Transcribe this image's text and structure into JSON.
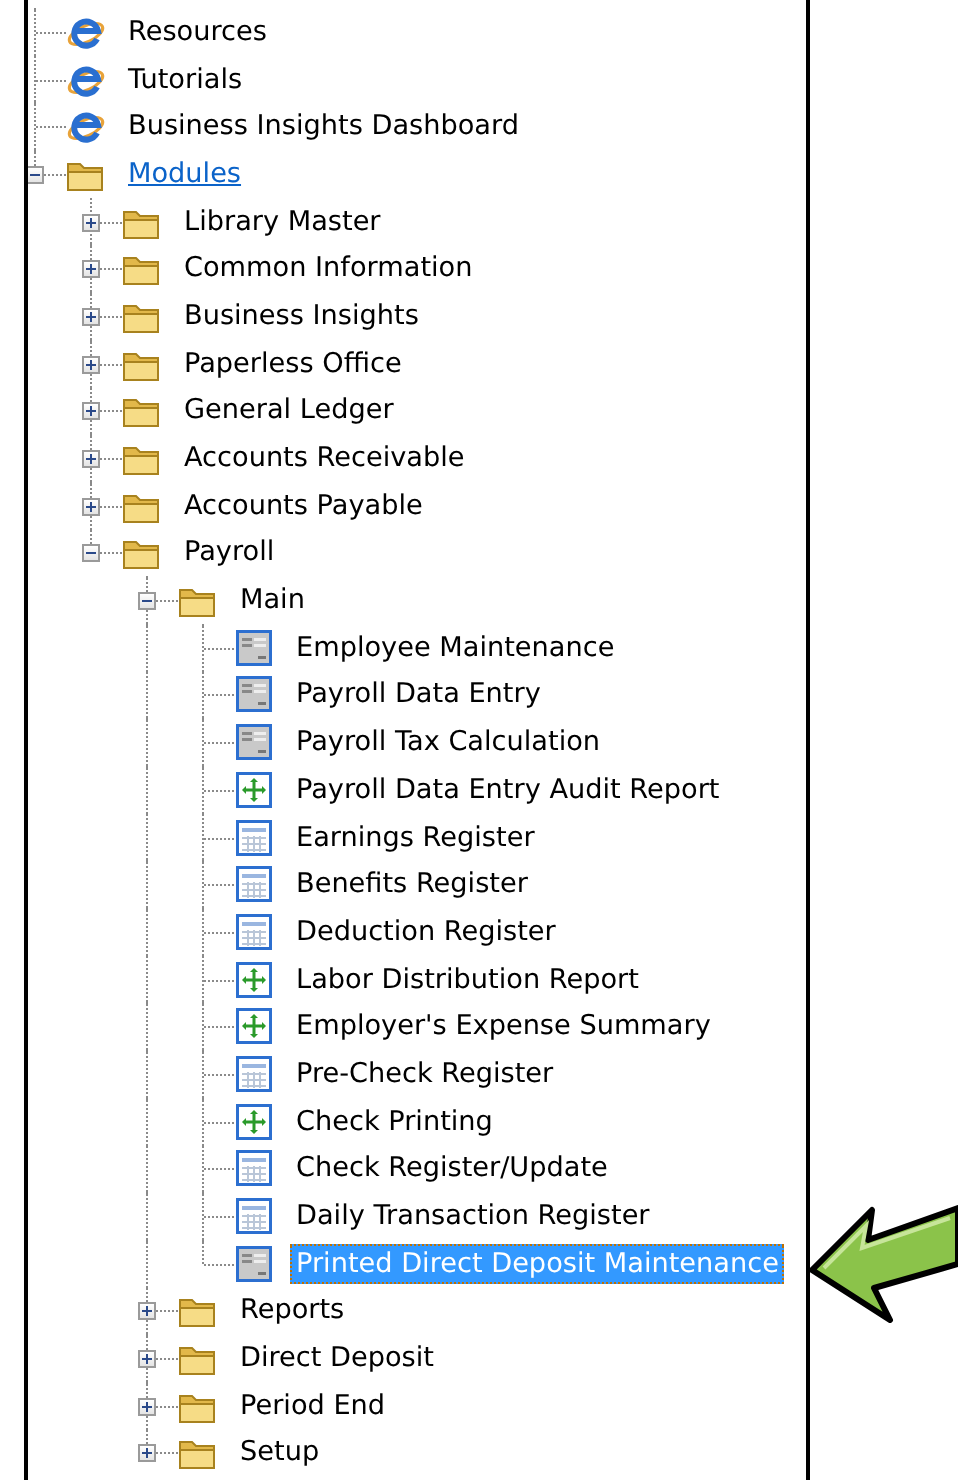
{
  "tree": [
    {
      "label": "Resources",
      "kind": "web",
      "selected": false,
      "hot": false
    },
    {
      "label": "Tutorials",
      "kind": "web",
      "selected": false,
      "hot": false
    },
    {
      "label": "Business Insights Dashboard",
      "kind": "web",
      "selected": false,
      "hot": false
    },
    {
      "label": "Modules",
      "kind": "folder",
      "expanded": true,
      "selected": false,
      "hot": true,
      "children": [
        {
          "label": "Library Master",
          "kind": "folder",
          "expanded": false,
          "selected": false,
          "hot": false
        },
        {
          "label": "Common Information",
          "kind": "folder",
          "expanded": false,
          "selected": false,
          "hot": false
        },
        {
          "label": "Business Insights",
          "kind": "folder",
          "expanded": false,
          "selected": false,
          "hot": false
        },
        {
          "label": "Paperless Office",
          "kind": "folder",
          "expanded": false,
          "selected": false,
          "hot": false
        },
        {
          "label": "General Ledger",
          "kind": "folder",
          "expanded": false,
          "selected": false,
          "hot": false
        },
        {
          "label": "Accounts Receivable",
          "kind": "folder",
          "expanded": false,
          "selected": false,
          "hot": false
        },
        {
          "label": "Accounts Payable",
          "kind": "folder",
          "expanded": false,
          "selected": false,
          "hot": false
        },
        {
          "label": "Payroll",
          "kind": "folder",
          "expanded": true,
          "selected": false,
          "hot": false,
          "children": [
            {
              "label": "Main",
              "kind": "folder",
              "expanded": true,
              "selected": false,
              "hot": false,
              "children": [
                {
                  "label": "Employee Maintenance",
                  "kind": "form",
                  "selected": false,
                  "hot": false
                },
                {
                  "label": "Payroll Data Entry",
                  "kind": "form",
                  "selected": false,
                  "hot": false
                },
                {
                  "label": "Payroll Tax Calculation",
                  "kind": "form",
                  "selected": false,
                  "hot": false
                },
                {
                  "label": "Payroll Data Entry Audit Report",
                  "kind": "task",
                  "selected": false,
                  "hot": false
                },
                {
                  "label": "Earnings Register",
                  "kind": "report",
                  "selected": false,
                  "hot": false
                },
                {
                  "label": "Benefits Register",
                  "kind": "report",
                  "selected": false,
                  "hot": false
                },
                {
                  "label": "Deduction Register",
                  "kind": "report",
                  "selected": false,
                  "hot": false
                },
                {
                  "label": "Labor Distribution Report",
                  "kind": "task",
                  "selected": false,
                  "hot": false
                },
                {
                  "label": "Employer's Expense Summary",
                  "kind": "task",
                  "selected": false,
                  "hot": false
                },
                {
                  "label": "Pre-Check Register",
                  "kind": "report",
                  "selected": false,
                  "hot": false
                },
                {
                  "label": "Check Printing",
                  "kind": "task",
                  "selected": false,
                  "hot": false
                },
                {
                  "label": "Check Register/Update",
                  "kind": "report",
                  "selected": false,
                  "hot": false
                },
                {
                  "label": "Daily Transaction Register",
                  "kind": "report",
                  "selected": false,
                  "hot": false
                },
                {
                  "label": "Printed Direct Deposit Maintenance",
                  "kind": "form",
                  "selected": true,
                  "hot": false
                }
              ]
            },
            {
              "label": "Reports",
              "kind": "folder",
              "expanded": false,
              "selected": false,
              "hot": false
            },
            {
              "label": "Direct Deposit",
              "kind": "folder",
              "expanded": false,
              "selected": false,
              "hot": false
            },
            {
              "label": "Period End",
              "kind": "folder",
              "expanded": false,
              "selected": false,
              "hot": false
            },
            {
              "label": "Setup",
              "kind": "folder",
              "expanded": false,
              "selected": false,
              "hot": false
            }
          ]
        }
      ]
    }
  ]
}
